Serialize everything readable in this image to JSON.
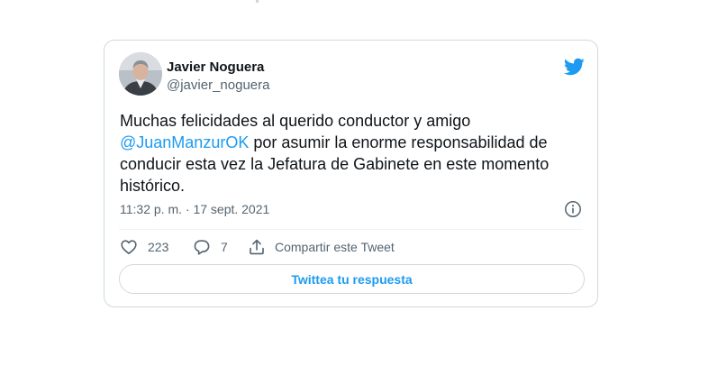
{
  "tweet": {
    "author": {
      "name": "Javier Noguera",
      "handle": "@javier_noguera",
      "avatar_icon": "person-avatar"
    },
    "text_lead": "Muchas felicidades al querido conductor y amigo",
    "mention": "@JuanManzurOK",
    "text_tail": "por asumir la enorme responsabilidad de conducir esta vez la Jefatura de Gabinete en este momento histórico.",
    "timestamp": "11:32 p. m. · 17 sept. 2021",
    "actions": {
      "likes": "223",
      "replies": "7",
      "share_label": "Compartir este Tweet"
    },
    "reply_button_label": "Twittea tu respuesta"
  },
  "colors": {
    "brand": "#1d9bf0",
    "text_primary": "#0f1419",
    "text_secondary": "#536471",
    "border": "#cfd9de"
  },
  "icons": [
    "twitter-bird-icon",
    "info-icon",
    "heart-icon",
    "reply-bubble-icon",
    "share-icon"
  ]
}
